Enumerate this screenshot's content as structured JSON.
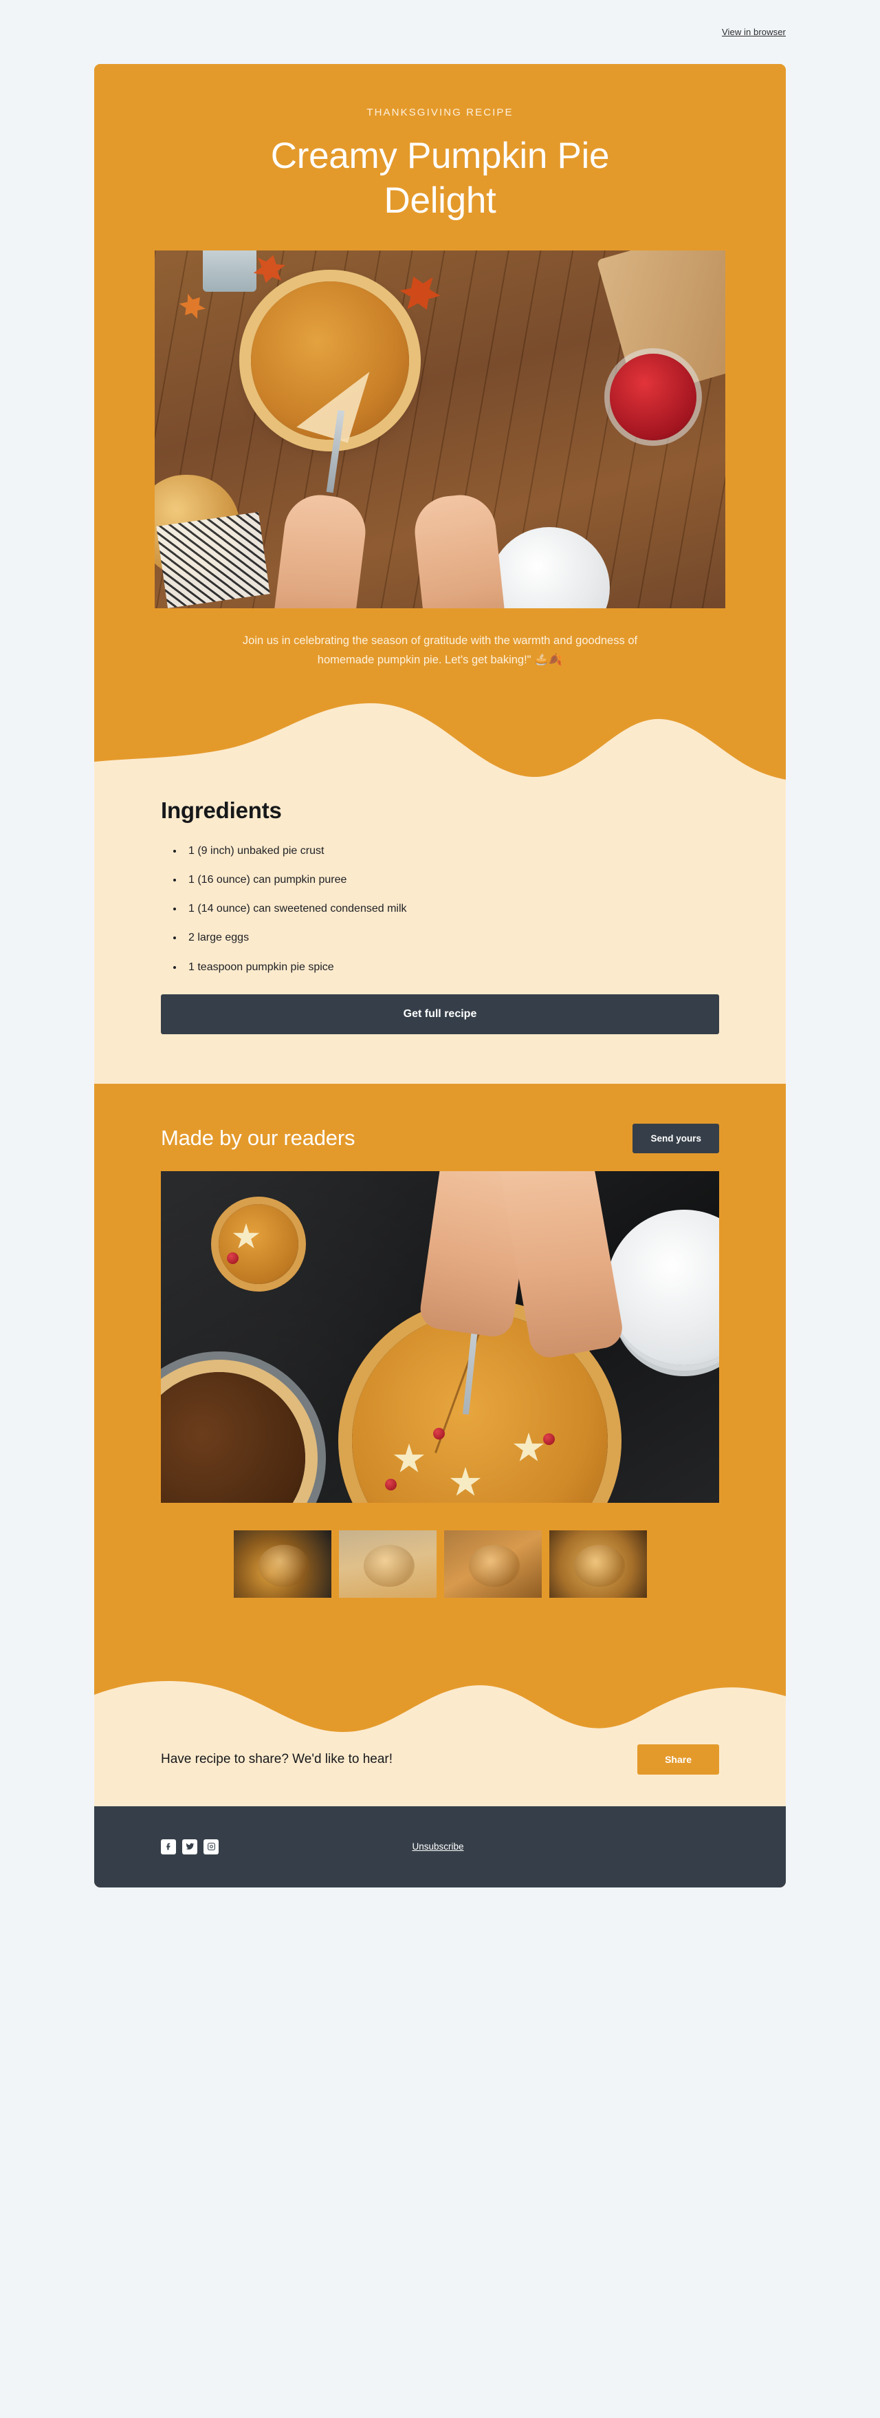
{
  "preheader": {
    "view_in_browser": "View in browser"
  },
  "hero": {
    "eyebrow": "THANKSGIVING RECIPE",
    "title": "Creamy Pumpkin Pie Delight",
    "photo_alt": "overhead-pumpkin-pie-on-wooden-table",
    "body": "Join us in celebrating the season of gratitude with the warmth and goodness of homemade pumpkin pie. Let's get baking!\" 🥧🍂"
  },
  "ingredients": {
    "title": "Ingredients",
    "items": [
      "1 (9 inch) unbaked pie crust",
      "1 (16 ounce) can pumpkin puree",
      "1 (14 ounce) can sweetened condensed milk",
      "2 large eggs",
      "1 teaspoon pumpkin pie spice"
    ],
    "cta_label": "Get full recipe"
  },
  "readers": {
    "title": "Made by our readers",
    "cta_label": "Send yours",
    "photo_alt": "hands-slicing-pumpkin-pie-on-dark-slate",
    "thumbnails": [
      {
        "alt": "mini-pumpkin-pies-with-cream-stars"
      },
      {
        "alt": "pumpkin-pie-slice-on-plate"
      },
      {
        "alt": "pumpkin-pie-with-autumn-leaves-on-wood"
      },
      {
        "alt": "whole-pumpkin-pie-close-up"
      }
    ]
  },
  "share": {
    "text": "Have recipe to share? We'd like to hear!",
    "cta_label": "Share"
  },
  "footer": {
    "socials": [
      {
        "name": "facebook-icon"
      },
      {
        "name": "twitter-icon"
      },
      {
        "name": "instagram-icon"
      }
    ],
    "unsubscribe": "Unsubscribe"
  },
  "colors": {
    "brand_orange": "#e49a2b",
    "cream": "#fceacd",
    "dark_slate": "#363f49",
    "page_bg": "#f1f5f8"
  }
}
